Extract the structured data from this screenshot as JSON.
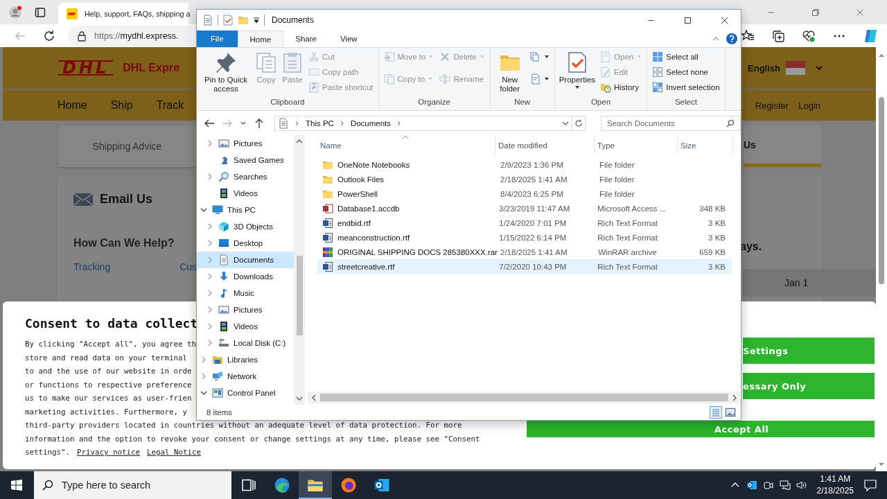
{
  "browser": {
    "tab": {
      "title": "Help, support, FAQs, shipping a",
      "selected": true
    },
    "address": {
      "scheme": "https://",
      "host": "mydhl.express."
    }
  },
  "page": {
    "brand": "DHL",
    "site_title": "DHL Expre",
    "language": "English",
    "nav": [
      "Home",
      "Ship",
      "Track"
    ],
    "account_links": [
      "Register",
      "Login"
    ],
    "shipping_advice": "Shipping Advice",
    "right_card": "Us",
    "email_heading": "Email Us",
    "help_heading": "How Can We Help?",
    "help_links": [
      "Tracking",
      "Cus"
    ],
    "notice_fragment": "ays.",
    "calendar_cell": "Jan 1"
  },
  "consent": {
    "title": "Consent to data collect",
    "lines": [
      "By clicking \"Accept all\", you agree th",
      "store and read data on your terminal",
      "to and the use of our website in orde",
      "or functions to respective preference",
      "us to make our services as user-frien",
      "marketing activities.  Furthermore, y",
      "third-party providers located in countries without an adequate level of data protection. For more",
      "information and the option to revoke your consent or change settings at any time, please see \"Consent"
    ],
    "last_line": "settings\".",
    "links": [
      "Privacy notice",
      "Legal Notice"
    ],
    "buttons": [
      {
        "label": "Settings",
        "kind": "partial"
      },
      {
        "label": "essary Only",
        "kind": "partial"
      },
      {
        "label": "Accept All",
        "kind": "wide"
      }
    ]
  },
  "explorer": {
    "title": "Documents",
    "tabs": [
      {
        "label": "File",
        "kind": "menu",
        "selected": false
      },
      {
        "label": "Home",
        "kind": "tab",
        "selected": true
      },
      {
        "label": "Share",
        "kind": "tab",
        "selected": false
      },
      {
        "label": "View",
        "kind": "tab",
        "selected": false
      }
    ],
    "ribbon": [
      {
        "label": "Clipboard",
        "large": [
          {
            "label": "Pin to Quick access",
            "kind": "pin",
            "disabled": false,
            "dropdown": false
          },
          {
            "label": "Copy",
            "kind": "copy",
            "disabled": true,
            "dropdown": false
          },
          {
            "label": "Paste",
            "kind": "paste",
            "disabled": true,
            "dropdown": false
          }
        ],
        "columns": [
          [
            {
              "label": "Cut",
              "kind": "cut",
              "disabled": true,
              "dropdown": false
            },
            {
              "label": "Copy path",
              "kind": "copy-path",
              "disabled": true,
              "dropdown": false
            },
            {
              "label": "Paste shortcut",
              "kind": "paste-shortcut",
              "disabled": true,
              "dropdown": false
            }
          ]
        ]
      },
      {
        "label": "Organize",
        "columns": [
          [
            {
              "label": "Move to",
              "kind": "move-to",
              "disabled": true,
              "dropdown": true
            },
            {
              "label": "Copy to",
              "kind": "copy-to",
              "disabled": true,
              "dropdown": true
            }
          ],
          [
            {
              "label": "Delete",
              "kind": "delete",
              "disabled": true,
              "dropdown": true
            },
            {
              "label": "Rename",
              "kind": "rename",
              "disabled": true,
              "dropdown": false
            }
          ]
        ]
      },
      {
        "label": "New",
        "large": [
          {
            "label": "New folder",
            "kind": "new-folder",
            "disabled": false,
            "dropdown": false
          }
        ],
        "columns": [
          [
            {
              "kind": "new-item",
              "disabled": false,
              "dropdown": true
            },
            {
              "kind": "easy-access",
              "disabled": false,
              "dropdown": true
            }
          ]
        ]
      },
      {
        "label": "Open",
        "large": [
          {
            "label": "Properties",
            "kind": "properties",
            "disabled": false,
            "dropdown": true
          }
        ],
        "columns": [
          [
            {
              "label": "Open",
              "kind": "open",
              "disabled": true,
              "dropdown": true
            },
            {
              "label": "Edit",
              "kind": "edit",
              "disabled": true,
              "dropdown": false
            },
            {
              "label": "History",
              "kind": "history",
              "disabled": false,
              "dropdown": false
            }
          ]
        ]
      },
      {
        "label": "Select",
        "columns": [
          [
            {
              "label": "Select all",
              "kind": "select-all",
              "disabled": false,
              "dropdown": false
            },
            {
              "label": "Select none",
              "kind": "select-none",
              "disabled": false,
              "dropdown": false
            },
            {
              "label": "Invert selection",
              "kind": "invert",
              "disabled": false,
              "dropdown": false
            }
          ]
        ]
      }
    ],
    "path": [
      "This PC",
      "Documents"
    ],
    "search": {
      "placeholder": "Search Documents"
    },
    "navigation": [
      {
        "children": [
          {
            "label": "Pictures",
            "kind": "pictures",
            "expandable": true,
            "expanded": false,
            "selected": false
          },
          {
            "label": "Saved Games",
            "kind": "games",
            "expandable": false,
            "selected": false
          },
          {
            "label": "Searches",
            "kind": "searches",
            "expandable": true,
            "expanded": false,
            "selected": false
          },
          {
            "label": "Videos",
            "kind": "videos",
            "expandable": false,
            "selected": false
          }
        ]
      },
      {
        "label": "This PC",
        "kind": "pc",
        "expandable": true,
        "expanded": true,
        "selected": false,
        "children": [
          {
            "label": "3D Objects",
            "kind": "objects",
            "expandable": true,
            "expanded": false,
            "selected": false
          },
          {
            "label": "Desktop",
            "kind": "desktop",
            "expandable": true,
            "expanded": false,
            "selected": false
          },
          {
            "label": "Documents",
            "kind": "documents",
            "expandable": true,
            "expanded": false,
            "selected": true
          },
          {
            "label": "Downloads",
            "kind": "downloads",
            "expandable": true,
            "expanded": false,
            "selected": false
          },
          {
            "label": "Music",
            "kind": "music",
            "expandable": true,
            "expanded": false,
            "selected": false
          },
          {
            "label": "Pictures",
            "kind": "pictures",
            "expandable": true,
            "expanded": false,
            "selected": false
          },
          {
            "label": "Videos",
            "kind": "videos",
            "expandable": true,
            "expanded": false,
            "selected": false
          },
          {
            "label": "Local Disk (C:)",
            "kind": "disk",
            "expandable": true,
            "expanded": false,
            "selected": false
          }
        ]
      },
      {
        "label": "Libraries",
        "kind": "libraries",
        "expandable": true,
        "expanded": false,
        "selected": false
      },
      {
        "label": "Network",
        "kind": "network",
        "expandable": true,
        "expanded": false,
        "selected": false
      },
      {
        "label": "Control Panel",
        "kind": "control-panel",
        "expandable": true,
        "expanded": true,
        "selected": false
      }
    ],
    "columns": [
      "Name",
      "Date modified",
      "Type",
      "Size"
    ],
    "files": [
      {
        "name": "OneNote Notebooks",
        "kind": "folder",
        "date": "2/9/2023 1:36 PM",
        "type": "File folder",
        "selected": false
      },
      {
        "name": "Outlook Files",
        "kind": "folder",
        "date": "2/18/2025 1:41 AM",
        "type": "File folder",
        "selected": false
      },
      {
        "name": "PowerShell",
        "kind": "folder",
        "date": "8/4/2023 6:25 PM",
        "type": "File folder",
        "selected": false
      },
      {
        "name": "Database1.accdb",
        "kind": "access",
        "date": "3/23/2019 11:47 AM",
        "type": "Microsoft Access ...",
        "size": "348 KB",
        "selected": false
      },
      {
        "name": "endbid.rtf",
        "kind": "word",
        "date": "1/24/2020 7:01 PM",
        "type": "Rich Text Format",
        "size": "3 KB",
        "selected": false
      },
      {
        "name": "meanconstruction.rtf",
        "kind": "word",
        "date": "1/15/2022 6:14 PM",
        "type": "Rich Text Format",
        "size": "3 KB",
        "selected": false
      },
      {
        "name": "ORIGINAL SHIPPING DOCS 285380XXX.rar",
        "kind": "rar",
        "date": "2/18/2025 1:41 AM",
        "type": "WinRAR archive",
        "size": "659 KB",
        "selected": false
      },
      {
        "name": "streetcreative.rtf",
        "kind": "word",
        "date": "7/2/2020 10:43 PM",
        "type": "Rich Text Format",
        "size": "3 KB",
        "selected": true
      }
    ],
    "status": "8 items"
  },
  "taskbar": {
    "search_placeholder": "Type here to search",
    "apps": [
      {
        "kind": "task-view",
        "selected": false
      },
      {
        "kind": "edge",
        "selected": false
      },
      {
        "kind": "explorer",
        "selected": true
      },
      {
        "kind": "firefox",
        "selected": false
      },
      {
        "kind": "outlook",
        "selected": false
      }
    ],
    "time": "1:41 AM",
    "date": "2/18/2025"
  }
}
